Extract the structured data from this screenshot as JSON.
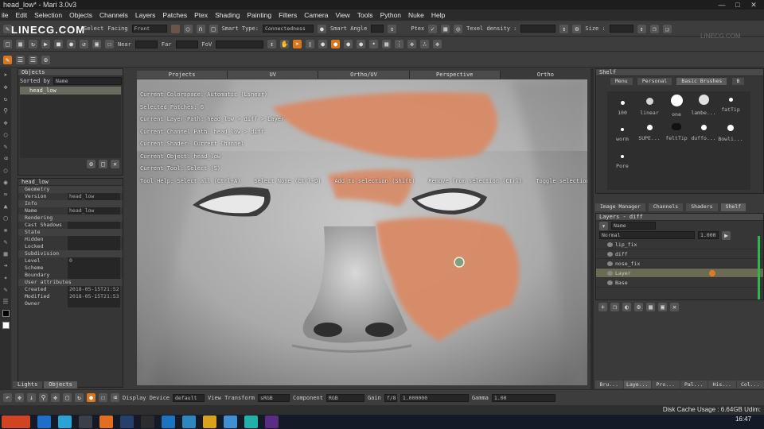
{
  "window": {
    "title": "head_low* - Mari 3.0v3"
  },
  "menu": [
    "ile",
    "Edit",
    "Selection",
    "Objects",
    "Channels",
    "Layers",
    "Patches",
    "Ptex",
    "Shading",
    "Painting",
    "Filters",
    "Camera",
    "View",
    "Tools",
    "Python",
    "Nuke",
    "Help"
  ],
  "toolbar1": {
    "select_label": "Select",
    "facing_label": "Facing",
    "facing_value": "Front",
    "smart_type_label": "Smart Type:",
    "smart_type_value": "Connectedness",
    "smart_angle_label": "Smart Angle",
    "ptex_label": "Ptex",
    "texel_label": "Texel density :",
    "size_label": "Size :"
  },
  "toolbar2": {
    "near_label": "Near",
    "far_label": "Far",
    "fov_label": "FoV"
  },
  "logo": "LINECG.COM",
  "watermark": "LINECG.COM",
  "objects_panel": {
    "title": "Objects",
    "sorted_label": "Sorted by",
    "sorted_value": "Name",
    "items": [
      "head_low"
    ]
  },
  "properties": {
    "object_name": "head_low",
    "rows": [
      {
        "type": "section",
        "label": "Geometry"
      },
      {
        "type": "row",
        "key": "Version",
        "value": "head_low"
      },
      {
        "type": "section",
        "label": "Info"
      },
      {
        "type": "row",
        "key": "Name",
        "value": "head_low"
      },
      {
        "type": "section",
        "label": "Rendering"
      },
      {
        "type": "row",
        "key": "Cast Shadows",
        "value": ""
      },
      {
        "type": "section",
        "label": "State"
      },
      {
        "type": "row",
        "key": "Hidden",
        "value": ""
      },
      {
        "type": "row",
        "key": "Locked",
        "value": ""
      },
      {
        "type": "section",
        "label": "Subdivision"
      },
      {
        "type": "row",
        "key": "Level",
        "value": "0"
      },
      {
        "type": "row",
        "key": "Scheme",
        "value": ""
      },
      {
        "type": "row",
        "key": "Boundary",
        "value": ""
      },
      {
        "type": "section",
        "label": "User attributes"
      },
      {
        "type": "row",
        "key": "Created",
        "value": "2018-05-15T21:52"
      },
      {
        "type": "row",
        "key": "Modified",
        "value": "2018-05-15T21:53"
      },
      {
        "type": "row",
        "key": "Owner",
        "value": ""
      }
    ]
  },
  "left_bottom_tabs": [
    "Lights",
    "Objects"
  ],
  "viewport_tabs": [
    "Projects",
    "UV",
    "Ortho/UV",
    "Perspective",
    "Ortho"
  ],
  "hud": {
    "lines": [
      "Current Colorspace: Automatic (Linear)",
      "Selected Patches: 6",
      "Current Layer Path: head_low > diff > Layer",
      "Current Channel Path: head_low > diff",
      "Current Shader: Current Channel",
      "Current Object: head_low",
      "Current Tool: Select (S)"
    ],
    "tool_help": "Tool Help: Select all (Ctrl+A)    Select None (Ctrl+D)    Add to selection (Shift)    Remove from selection (Ctrl)    Toggle selection (Meta)"
  },
  "shelf": {
    "title": "Shelf",
    "tabs": [
      "Menu",
      "Personal",
      "Basic Brushes",
      "B"
    ],
    "brushes": [
      "100",
      "linear",
      "one",
      "lambe...",
      "fatTip",
      "worm",
      "SUPE...",
      "feltTip",
      "duffo...",
      "Bowli...",
      "Pore"
    ]
  },
  "manager_tabs": [
    "Image Manager",
    "Channels",
    "Shaders",
    "Shelf"
  ],
  "layers": {
    "title": "Layers - diff",
    "filter": "Name",
    "blend": "Normal",
    "opacity": "1.000",
    "items": [
      {
        "name": "lip_fix",
        "selected": false
      },
      {
        "name": "diff",
        "selected": false
      },
      {
        "name": "nose_fix",
        "selected": false
      },
      {
        "name": "Layer",
        "selected": true
      },
      {
        "name": "Base",
        "selected": false
      }
    ]
  },
  "right_bottom_tabs": [
    "Bru...",
    "Laye...",
    "Pro...",
    "Pal...",
    "His...",
    "Col..."
  ],
  "bottombar": {
    "display_device_label": "Display Device",
    "display_device_value": "default",
    "view_transform_label": "View Transform",
    "view_transform_value": "sRGB",
    "component_label": "Component",
    "component_value": "RGB",
    "gain_label": "Gain",
    "gain_value": "f/8",
    "gain_number": "1.000000",
    "gamma_label": "Gamma",
    "gamma_value": "1.00"
  },
  "status": {
    "disk": "Disk Cache Usage : 6.64GB Udim:"
  },
  "taskbar": {
    "time": "16:47"
  }
}
